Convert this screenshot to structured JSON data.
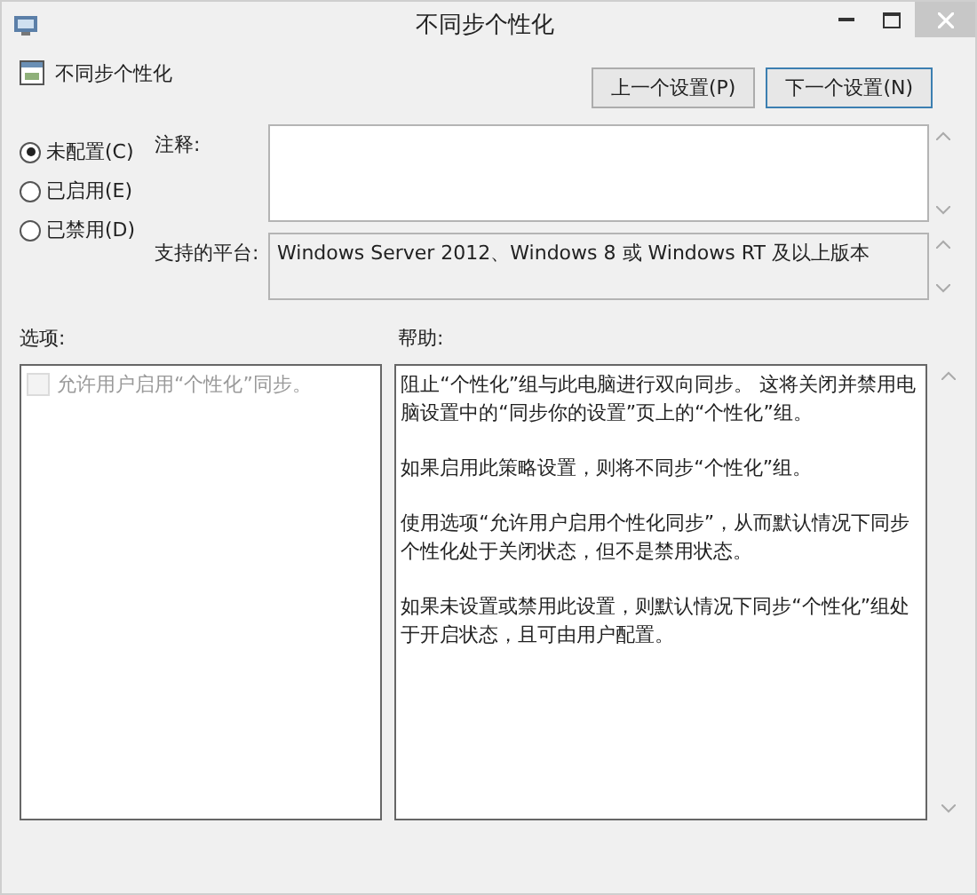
{
  "window": {
    "title": "不同步个性化"
  },
  "header": {
    "policy_name": "不同步个性化",
    "buttons": [
      {
        "label": "上一个设置(P)",
        "focused": false
      },
      {
        "label": "下一个设置(N)",
        "focused": true
      }
    ]
  },
  "state_options": [
    {
      "label": "未配置(C)",
      "selected": true
    },
    {
      "label": "已启用(E)",
      "selected": false
    },
    {
      "label": "已禁用(D)",
      "selected": false
    }
  ],
  "comment": {
    "label": "注释:"
  },
  "platform": {
    "label": "支持的平台:",
    "value": "Windows Server 2012、Windows 8 或 Windows RT 及以上版本"
  },
  "options": {
    "label": "选项:",
    "items": [
      {
        "label": "允许用户启用“个性化”同步。",
        "checked": false,
        "disabled": true
      }
    ]
  },
  "help": {
    "label": "帮助:",
    "paragraphs": [
      "阻止“个性化”组与此电脑进行双向同步。 这将关闭并禁用电脑设置中的“同步你的设置”页上的“个性化”组。",
      "如果启用此策略设置，则将不同步“个性化”组。",
      "使用选项“允许用户启用个性化同步”，从而默认情况下同步个性化处于关闭状态，但不是禁用状态。",
      "如果未设置或禁用此设置，则默认情况下同步“个性化”组处于开启状态，且可由用户配置。"
    ]
  }
}
